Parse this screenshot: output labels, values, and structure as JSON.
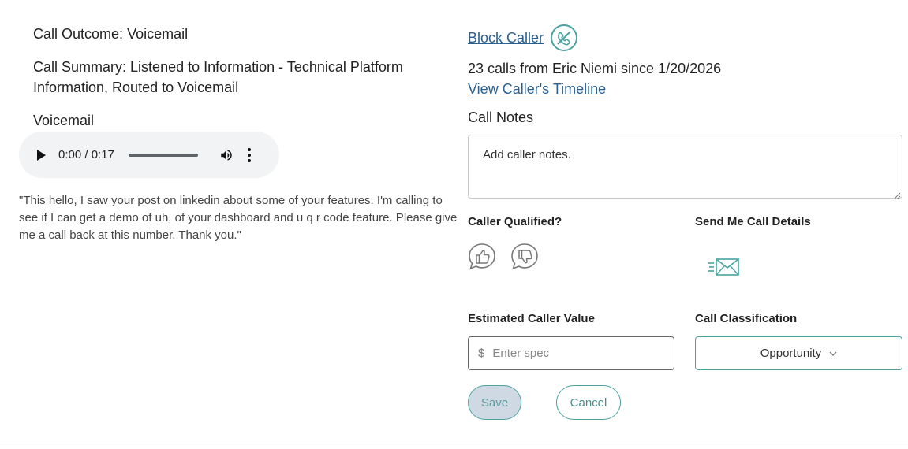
{
  "call": {
    "outcome_label": "Call Outcome:",
    "outcome_value": "Voicemail",
    "summary_label": "Call Summary:",
    "summary_value": "Listened to Information - Technical Platform Information, Routed to Voicemail",
    "voicemail_label": "Voicemail",
    "player_time": "0:00 / 0:17",
    "transcript": "\"This hello, I saw your post on linkedin about some of your features. I'm calling to see if I can get a demo of uh, of your dashboard and u q r code feature. Please give me a call back at this number. Thank you.\""
  },
  "caller": {
    "block_label": "Block Caller",
    "calls_count": "23 calls from Eric Niemi since 1/20/2026",
    "timeline_label": "View Caller's Timeline",
    "notes_label": "Call Notes",
    "notes_placeholder": "Add caller notes."
  },
  "form": {
    "qualified_label": "Caller Qualified?",
    "send_details_label": "Send Me Call Details",
    "ecv_label": "Estimated Caller Value",
    "ecv_currency": "$",
    "ecv_placeholder": "Enter spec",
    "classification_label": "Call Classification",
    "classification_value": "Opportunity",
    "save_label": "Save",
    "cancel_label": "Cancel"
  },
  "icons": {
    "block": "block-phone-icon",
    "thumb_up": "thumbs-up-icon",
    "thumb_down": "thumbs-down-icon",
    "send": "send-email-icon",
    "play": "play-icon",
    "volume": "volume-icon",
    "more": "more-vert-icon",
    "chevron": "chevron-down-icon"
  },
  "colors": {
    "accent": "#4aa3a2",
    "link": "#2b5f8f",
    "player_bg": "#f1f3f4"
  }
}
